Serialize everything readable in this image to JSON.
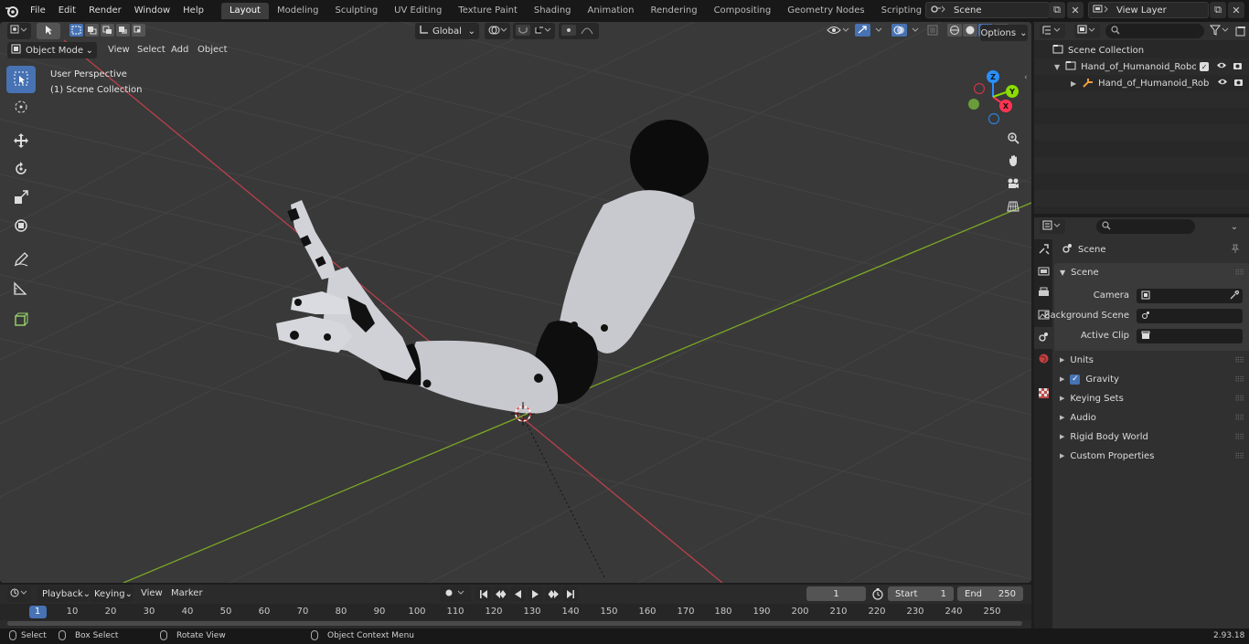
{
  "menu": [
    "File",
    "Edit",
    "Render",
    "Window",
    "Help"
  ],
  "workspaces": [
    "Layout",
    "Modeling",
    "Sculpting",
    "UV Editing",
    "Texture Paint",
    "Shading",
    "Animation",
    "Rendering",
    "Compositing",
    "Geometry Nodes",
    "Scripting"
  ],
  "active_workspace": "Layout",
  "scene_name": "Scene",
  "view_layer": "View Layer",
  "viewport": {
    "mode": "Object Mode",
    "menus": [
      "View",
      "Select",
      "Add",
      "Object"
    ],
    "orientation": "Global",
    "options_label": "Options",
    "perspective": "User Perspective",
    "collection": "(1) Scene Collection",
    "gizmo_axes": {
      "x": "X",
      "y": "Y",
      "z": "Z"
    }
  },
  "colors": {
    "accent": "#4772b3",
    "x_axis": "#ff3352",
    "y_axis": "#8bdc00",
    "z_axis": "#2890ff",
    "grid_red": "#d43a3a",
    "grid_green": "#7ba726"
  },
  "outliner": {
    "root": "Scene Collection",
    "items": [
      {
        "name": "Hand_of_Humanoid_Robot_O",
        "icon": "collection-icon"
      },
      {
        "name": "Hand_of_Humanoid_Rob",
        "icon": "armature-icon"
      }
    ]
  },
  "properties": {
    "context": "Scene",
    "panel": "Scene",
    "fields": [
      {
        "label": "Camera"
      },
      {
        "label": "Background Scene"
      },
      {
        "label": "Active Clip"
      }
    ],
    "subpanels": [
      "Units",
      "Gravity",
      "Keying Sets",
      "Audio",
      "Rigid Body World",
      "Custom Properties"
    ]
  },
  "timeline": {
    "menus": [
      "Playback",
      "Keying",
      "View",
      "Marker"
    ],
    "current_frame": "1",
    "start_label": "Start",
    "start": "1",
    "end_label": "End",
    "end": "250",
    "ticks": [
      "1",
      "10",
      "20",
      "30",
      "40",
      "50",
      "60",
      "70",
      "80",
      "90",
      "100",
      "110",
      "120",
      "130",
      "140",
      "150",
      "160",
      "170",
      "180",
      "190",
      "200",
      "210",
      "220",
      "230",
      "240",
      "250"
    ]
  },
  "statusbar": {
    "items": [
      "Select",
      "Box Select",
      "Rotate View",
      "Object Context Menu"
    ],
    "version": "2.93.18"
  }
}
